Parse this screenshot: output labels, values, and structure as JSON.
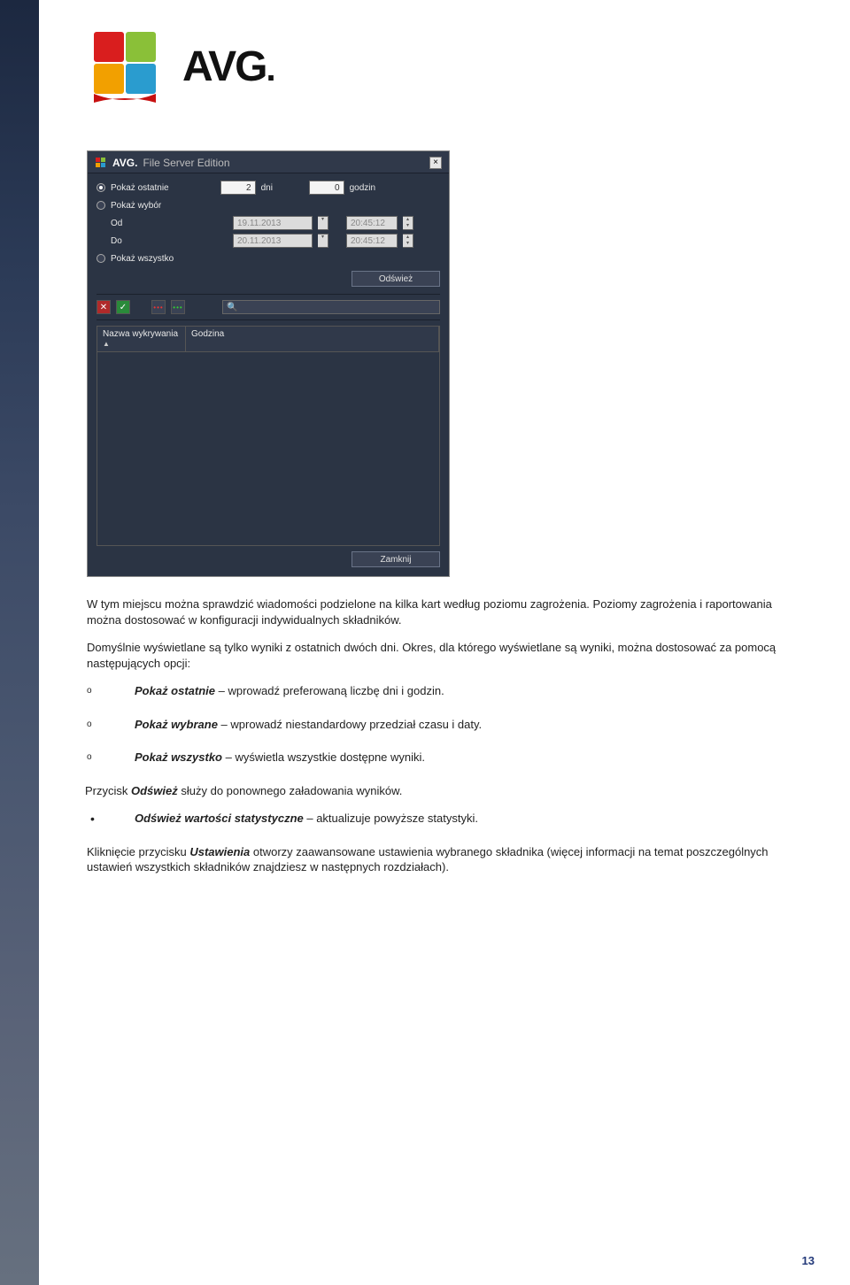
{
  "logo": {
    "brand": "AVG"
  },
  "app": {
    "title_brand": "AVG.",
    "title_sub": "File Server Edition",
    "close": "×",
    "opts": {
      "show_recent": "Pokaż ostatnie",
      "show_selection": "Pokaż wybór",
      "from": "Od",
      "to": "Do",
      "show_all": "Pokaż wszystko"
    },
    "inputs": {
      "days_value": "2",
      "days_label": "dni",
      "hours_value": "0",
      "hours_label": "godzin",
      "date_from": "19.11.2013",
      "time_from": "20:45:12",
      "date_to": "20.11.2013",
      "time_to": "20:45:12"
    },
    "buttons": {
      "refresh": "Odśwież",
      "close": "Zamknij"
    },
    "toolbar": {
      "x": "✕",
      "check": "✓"
    },
    "columns": {
      "name": "Nazwa wykrywania",
      "time": "Godzina"
    }
  },
  "doc": {
    "p1": "W tym miejscu można sprawdzić wiadomości podzielone na kilka kart według poziomu zagrożenia. Poziomy zagrożenia i raportowania można dostosować w konfiguracji indywidualnych składników.",
    "p2": "Domyślnie wyświetlane są tylko wyniki z ostatnich dwóch dni. Okres, dla którego wyświetlane są wyniki, można dostosować za pomocą następujących opcji:",
    "o1_b": "Pokaż ostatnie",
    "o1_t": " – wprowadź preferowaną liczbę dni i godzin.",
    "o2_b": "Pokaż wybrane",
    "o2_t": " – wprowadź niestandardowy przedział czasu i daty.",
    "o3_b": "Pokaż wszystko",
    "o3_t": " – wyświetla wszystkie dostępne wyniki.",
    "p3a": "Przycisk ",
    "p3b": "Odśwież",
    "p3c": " służy do ponownego załadowania wyników.",
    "b1_b": "Odśwież wartości statystyczne",
    "b1_t": " – aktualizuje powyższe statystyki.",
    "p4a": "Kliknięcie przycisku ",
    "p4b": "Ustawienia",
    "p4c": " otworzy zaawansowane ustawienia wybranego składnika (więcej informacji na temat poszczególnych ustawień wszystkich składników znajdziesz w następnych rozdziałach)."
  },
  "page_number": "13"
}
